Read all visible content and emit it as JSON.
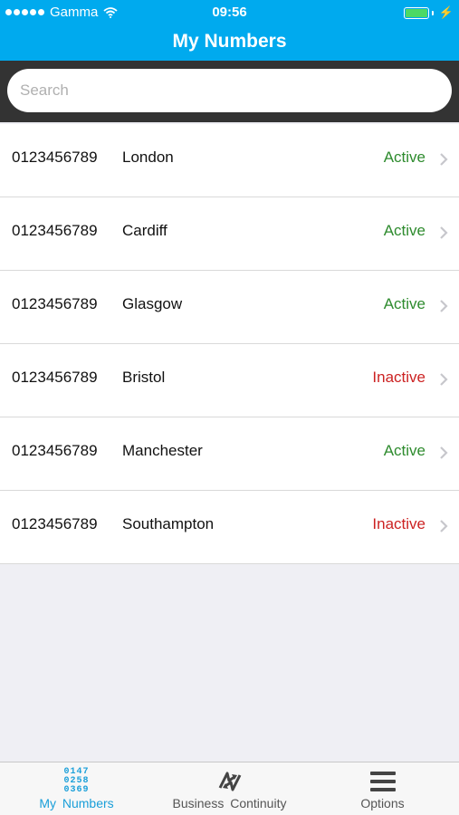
{
  "status_bar": {
    "carrier": "Gamma",
    "time": "09:56"
  },
  "nav": {
    "title": "My Numbers"
  },
  "search": {
    "placeholder": "Search"
  },
  "numbers": [
    {
      "number": "0123456789",
      "city": "London",
      "status": "Active"
    },
    {
      "number": "0123456789",
      "city": "Cardiff",
      "status": "Active"
    },
    {
      "number": "0123456789",
      "city": "Glasgow",
      "status": "Active"
    },
    {
      "number": "0123456789",
      "city": "Bristol",
      "status": "Inactive"
    },
    {
      "number": "0123456789",
      "city": "Manchester",
      "status": "Active"
    },
    {
      "number": "0123456789",
      "city": "Southampton",
      "status": "Inactive"
    }
  ],
  "tabbar": {
    "tabs": [
      {
        "label": "My Numbers",
        "icon": "number-pad-icon",
        "icon_digits": [
          "0147",
          "0258",
          "0369"
        ]
      },
      {
        "label": "Business Continuity",
        "icon": "redirect-arrows-icon"
      },
      {
        "label": "Options",
        "icon": "menu-icon"
      }
    ]
  },
  "colors": {
    "header": "#00aaee",
    "active": "#2e8b2e",
    "inactive": "#cc2222",
    "tab_active": "#1a9fd9"
  }
}
